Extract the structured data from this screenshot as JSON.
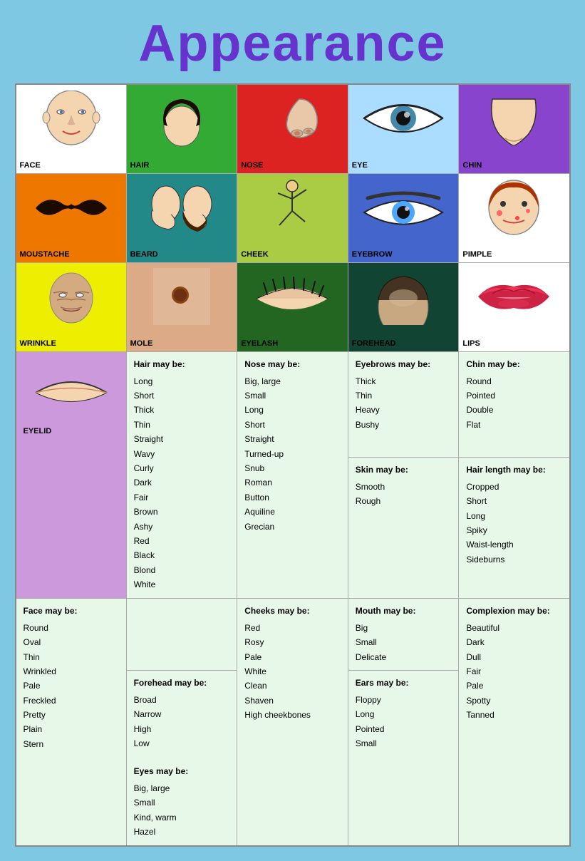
{
  "title": "Appearance",
  "rows": {
    "imageRow1": [
      {
        "label": "FACE",
        "bg": "white"
      },
      {
        "label": "HAIR",
        "bg": "green"
      },
      {
        "label": "NOSE",
        "bg": "red"
      },
      {
        "label": "EYE",
        "bg": "lightblue"
      },
      {
        "label": "CHIN",
        "bg": "purple"
      }
    ],
    "imageRow2": [
      {
        "label": "MOUSTACHE",
        "bg": "orange"
      },
      {
        "label": "BEARD",
        "bg": "teal"
      },
      {
        "label": "CHEEK",
        "bg": "yellow-green"
      },
      {
        "label": "EYEBROW",
        "bg": "blue"
      },
      {
        "label": "PIMPLE",
        "bg": "white"
      }
    ],
    "imageRow3": [
      {
        "label": "WRINKLE",
        "bg": "yellow"
      },
      {
        "label": "MOLE",
        "bg": "skin"
      },
      {
        "label": "EYELASH",
        "bg": "dark-green"
      },
      {
        "label": "FOREHEAD",
        "bg": "dark-teal"
      },
      {
        "label": "LIPS",
        "bg": "white"
      }
    ]
  },
  "textSections": {
    "eyelid": "EYELID",
    "face": {
      "heading": "Face may be:",
      "items": [
        "Round",
        "Oval",
        "Thin",
        "Wrinkled",
        "Pale",
        "Freckled",
        "Pretty",
        "Plain",
        "Stern"
      ]
    },
    "hair": {
      "heading": "Hair may be:",
      "items": [
        "Long",
        "Short",
        "Thick",
        "Thin",
        "Straight",
        "Wavy",
        "Curly",
        "Dark",
        "Fair",
        "Brown",
        "Ashy",
        "Red",
        "Black",
        "Blond",
        "White"
      ]
    },
    "nose": {
      "heading": "Nose may be:",
      "items": [
        "Big, large",
        "Small",
        "Long",
        "Short",
        "Straight",
        "Turned-up",
        "Snub",
        "Roman",
        "Button",
        "Aquiline",
        "Grecian"
      ]
    },
    "eyebrows": {
      "heading": "Eyebrows may be:",
      "items": [
        "Thick",
        "Thin",
        "Heavy",
        "Bushy"
      ]
    },
    "chin": {
      "heading": "Chin may be:",
      "items": [
        "Round",
        "Pointed",
        "Double",
        "Flat"
      ]
    },
    "skin": {
      "heading": "Skin may be:",
      "items": [
        "Smooth",
        "Rough"
      ]
    },
    "cheeks": {
      "heading": "Cheeks may be:",
      "items": [
        "Red",
        "Rosy",
        "Pale",
        "White",
        "Clean",
        "Shaven",
        "High cheekbones"
      ]
    },
    "mouth": {
      "heading": "Mouth may be:",
      "items": [
        "Big",
        "Small",
        "Delicate"
      ]
    },
    "hairLength": {
      "heading": "Hair length may be:",
      "items": [
        "Cropped",
        "Short",
        "Long",
        "Spiky",
        "Waist-length",
        "Sideburns"
      ]
    },
    "complexion": {
      "heading": "Complexion may be:",
      "items": [
        "Beautiful",
        "Dark",
        "Dull",
        "Fair",
        "Pale",
        "Spotty",
        "Tanned"
      ]
    },
    "forehead": {
      "heading": "Forehead may be:",
      "items": [
        "Broad",
        "Narrow",
        "High",
        "Low"
      ]
    },
    "eyes": {
      "heading": "Eyes may be:",
      "items": [
        "Big, large",
        "Small",
        "Kind, warm",
        "Hazel"
      ]
    },
    "ears": {
      "heading": "Ears may be:",
      "items": [
        "Floppy",
        "Long",
        "Pointed",
        "Small"
      ]
    }
  }
}
